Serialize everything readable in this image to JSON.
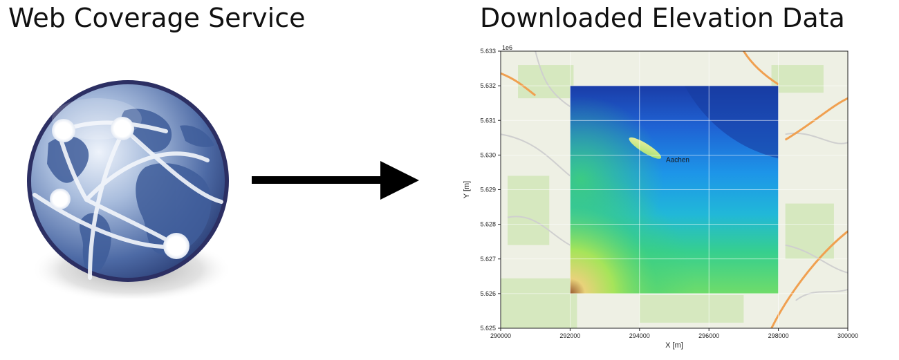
{
  "titles": {
    "left": "Web Coverage Service",
    "right": "Downloaded Elevation Data"
  },
  "icons": {
    "globe": "globe-network-icon",
    "arrow": "right-arrow-icon"
  },
  "chart_data": {
    "type": "heatmap",
    "title": "Downloaded Elevation Data",
    "xlabel": "X [m]",
    "ylabel": "Y [m]",
    "xlim": [
      290000,
      300000
    ],
    "ylim": [
      5625000,
      5633000
    ],
    "x_ticks": [
      290000,
      292000,
      294000,
      296000,
      298000,
      300000
    ],
    "y_ticks": [
      5625000,
      5626000,
      5627000,
      5628000,
      5629000,
      5630000,
      5631000,
      5632000,
      5633000
    ],
    "y_tick_labels": [
      "5.625",
      "5.626",
      "5.627",
      "5.628",
      "5.629",
      "5.630",
      "5.631",
      "5.632",
      "5.633"
    ],
    "y_offset_label": "1e6",
    "raster_extent": {
      "x": [
        292000,
        298000
      ],
      "y": [
        5626000,
        5632000
      ]
    },
    "grid": true,
    "basemap": "street map",
    "annotations": [
      {
        "text": "Aachen",
        "x": 295100,
        "y": 5629800
      }
    ],
    "colormap": [
      "#1030a0",
      "#1a70e0",
      "#20b0f0",
      "#30d090",
      "#a0e060",
      "#e0d070",
      "#a06030"
    ]
  }
}
